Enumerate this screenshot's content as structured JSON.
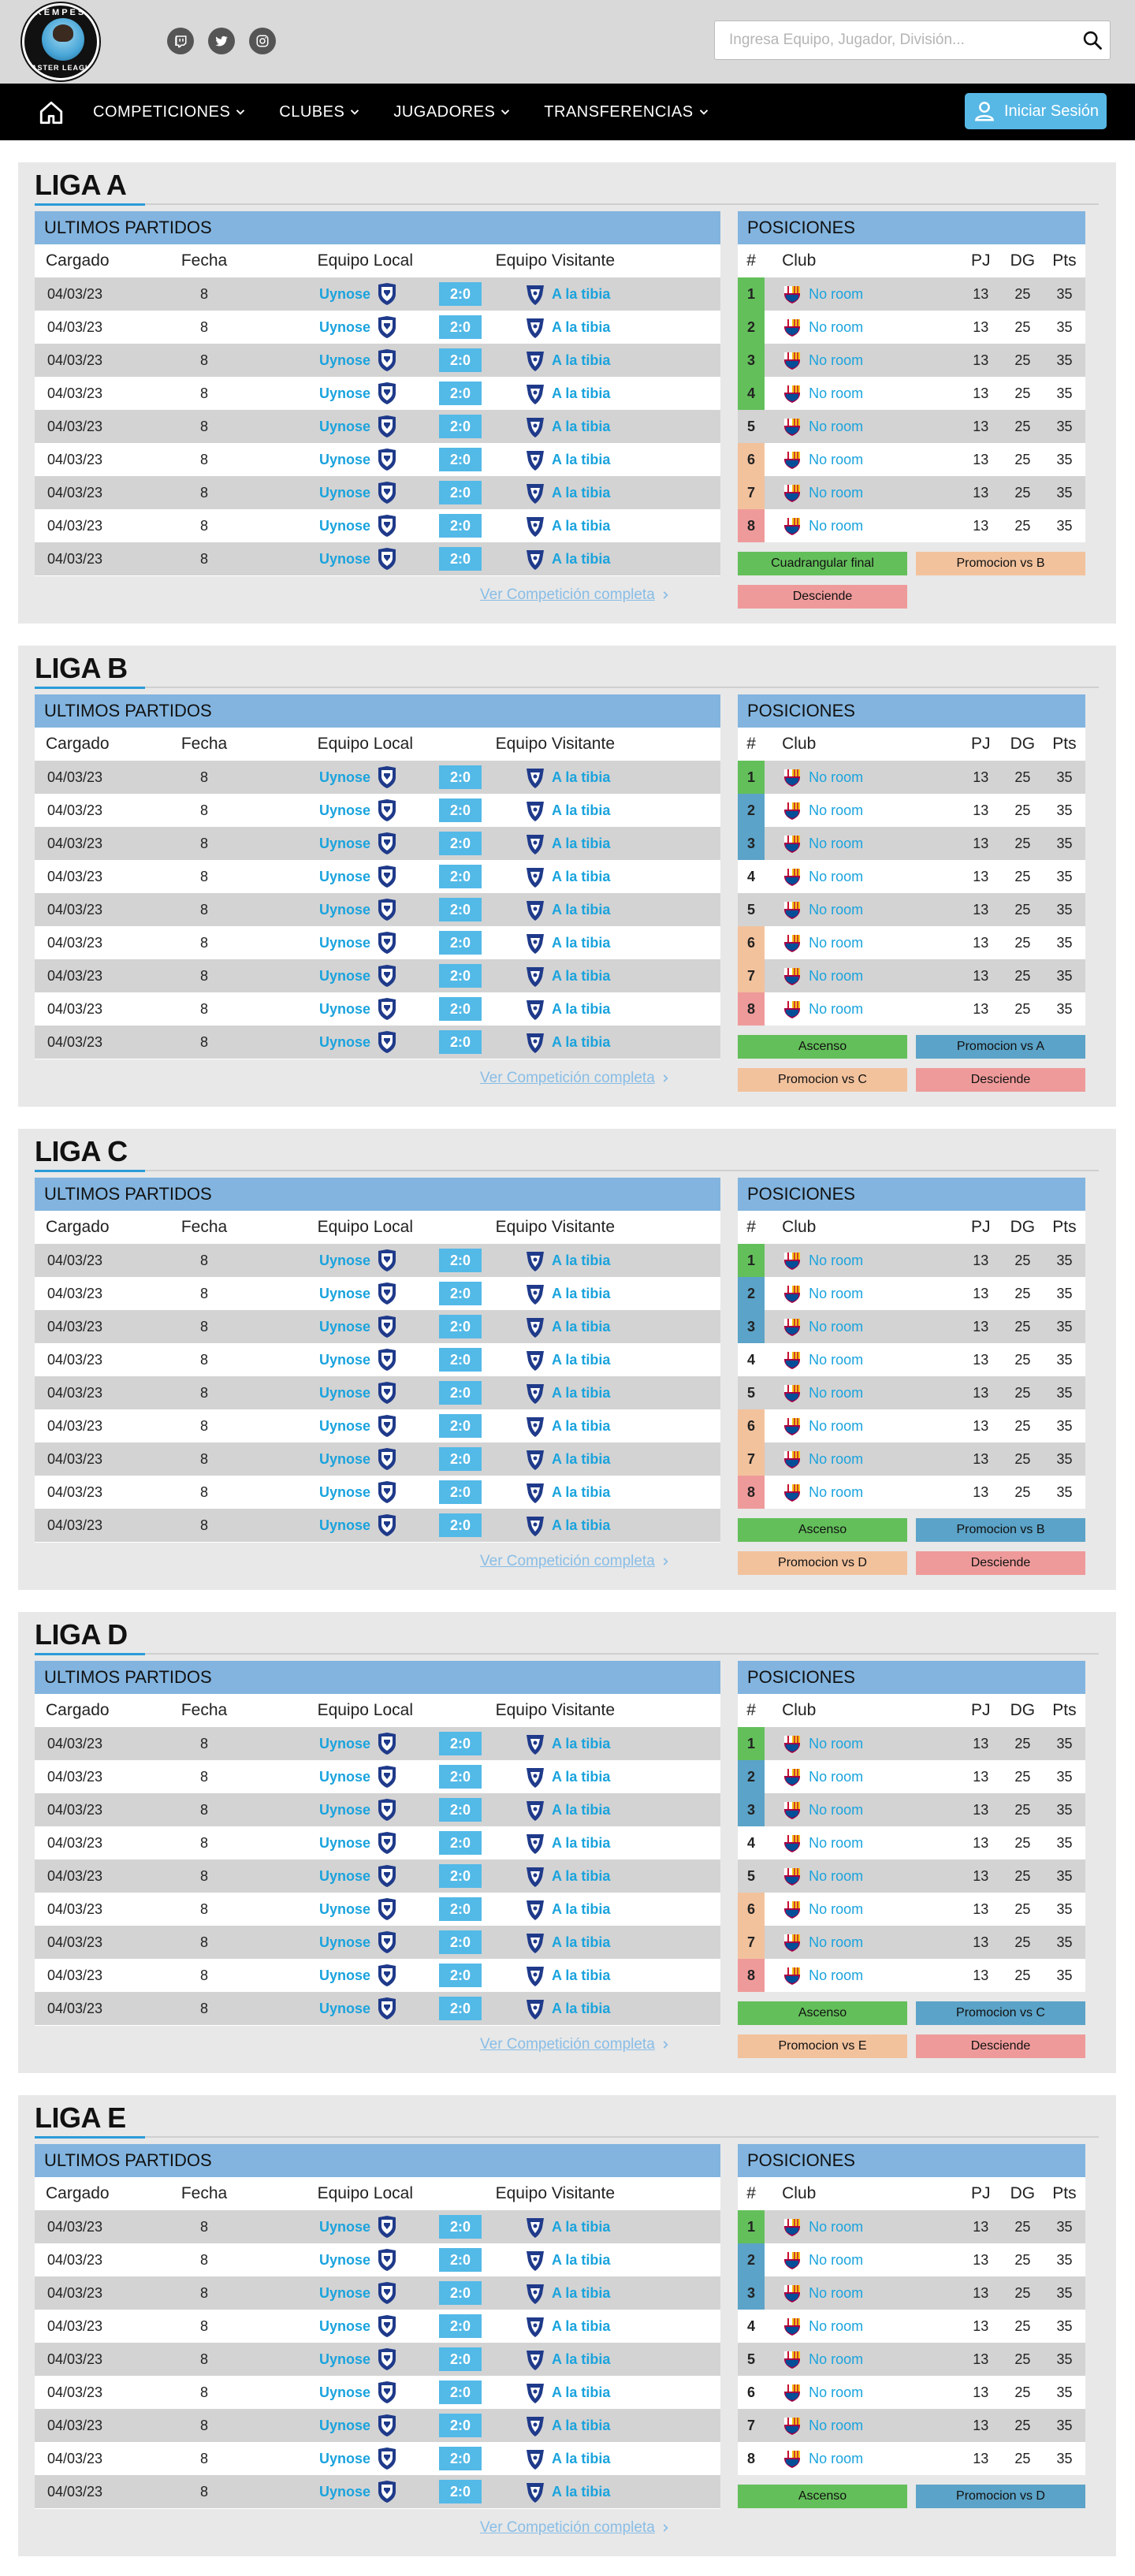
{
  "brand": {
    "logo_top": "KEMPES",
    "logo_bottom": "MASTER LEAGUE"
  },
  "socials": [
    {
      "name": "twitch",
      "icon": "twitch-icon"
    },
    {
      "name": "twitter",
      "icon": "twitter-icon"
    },
    {
      "name": "instagram",
      "icon": "instagram-icon"
    }
  ],
  "search": {
    "placeholder": "Ingresa Equipo, Jugador, División..."
  },
  "nav": {
    "items": [
      {
        "label": "COMPETICIONES"
      },
      {
        "label": "CLUBES"
      },
      {
        "label": "JUGADORES"
      },
      {
        "label": "TRANSFERENCIAS"
      }
    ],
    "login_label": "Iniciar Sesión"
  },
  "colors": {
    "green": "#63bf5a",
    "blue": "#5ba3c8",
    "peach": "#f2c29d",
    "red": "#ef9a9a",
    "accent": "#53b9e7",
    "header_blue": "#82b4df"
  },
  "labels": {
    "matches_header": "ULTIMOS PARTIDOS",
    "positions_header": "POSICIONES",
    "col_cargado": "Cargado",
    "col_fecha": "Fecha",
    "col_local": "Equipo Local",
    "col_visitante": "Equipo Visitante",
    "col_num": "#",
    "col_club": "Club",
    "col_pj": "PJ",
    "col_dg": "DG",
    "col_pts": "Pts",
    "see_full": "Ver Competición completa"
  },
  "match": {
    "date": "04/03/23",
    "fecha": "8",
    "local": "Uynose",
    "score": "2:0",
    "visitor": "A la tibia",
    "count": 9
  },
  "standing": {
    "club": "No room",
    "pj": "13",
    "dg": "25",
    "pts": "35",
    "count": 8
  },
  "leagues": [
    {
      "title": "LIGA A",
      "zones": [
        "green",
        "green",
        "green",
        "green",
        "none",
        "peach",
        "peach",
        "red"
      ],
      "legend": [
        {
          "label": "Cuadrangular final",
          "color": "green"
        },
        {
          "label": "Promocion vs B",
          "color": "peach"
        },
        {
          "label": "Desciende",
          "color": "red"
        }
      ]
    },
    {
      "title": "LIGA B",
      "zones": [
        "green",
        "blue",
        "blue",
        "none",
        "none",
        "peach",
        "peach",
        "red"
      ],
      "legend": [
        {
          "label": "Ascenso",
          "color": "green"
        },
        {
          "label": "Promocion vs A",
          "color": "blue"
        },
        {
          "label": "Promocion vs C",
          "color": "peach"
        },
        {
          "label": "Desciende",
          "color": "red"
        }
      ]
    },
    {
      "title": "LIGA C",
      "zones": [
        "green",
        "blue",
        "blue",
        "none",
        "none",
        "peach",
        "peach",
        "red"
      ],
      "legend": [
        {
          "label": "Ascenso",
          "color": "green"
        },
        {
          "label": "Promocion vs B",
          "color": "blue"
        },
        {
          "label": "Promocion vs D",
          "color": "peach"
        },
        {
          "label": "Desciende",
          "color": "red"
        }
      ]
    },
    {
      "title": "LIGA D",
      "zones": [
        "green",
        "blue",
        "blue",
        "none",
        "none",
        "peach",
        "peach",
        "red"
      ],
      "legend": [
        {
          "label": "Ascenso",
          "color": "green"
        },
        {
          "label": "Promocion vs C",
          "color": "blue"
        },
        {
          "label": "Promocion vs E",
          "color": "peach"
        },
        {
          "label": "Desciende",
          "color": "red"
        }
      ]
    },
    {
      "title": "LIGA E",
      "zones": [
        "green",
        "blue",
        "blue",
        "none",
        "none",
        "none",
        "none",
        "none"
      ],
      "legend": [
        {
          "label": "Ascenso",
          "color": "green"
        },
        {
          "label": "Promocion vs D",
          "color": "blue"
        }
      ]
    }
  ]
}
